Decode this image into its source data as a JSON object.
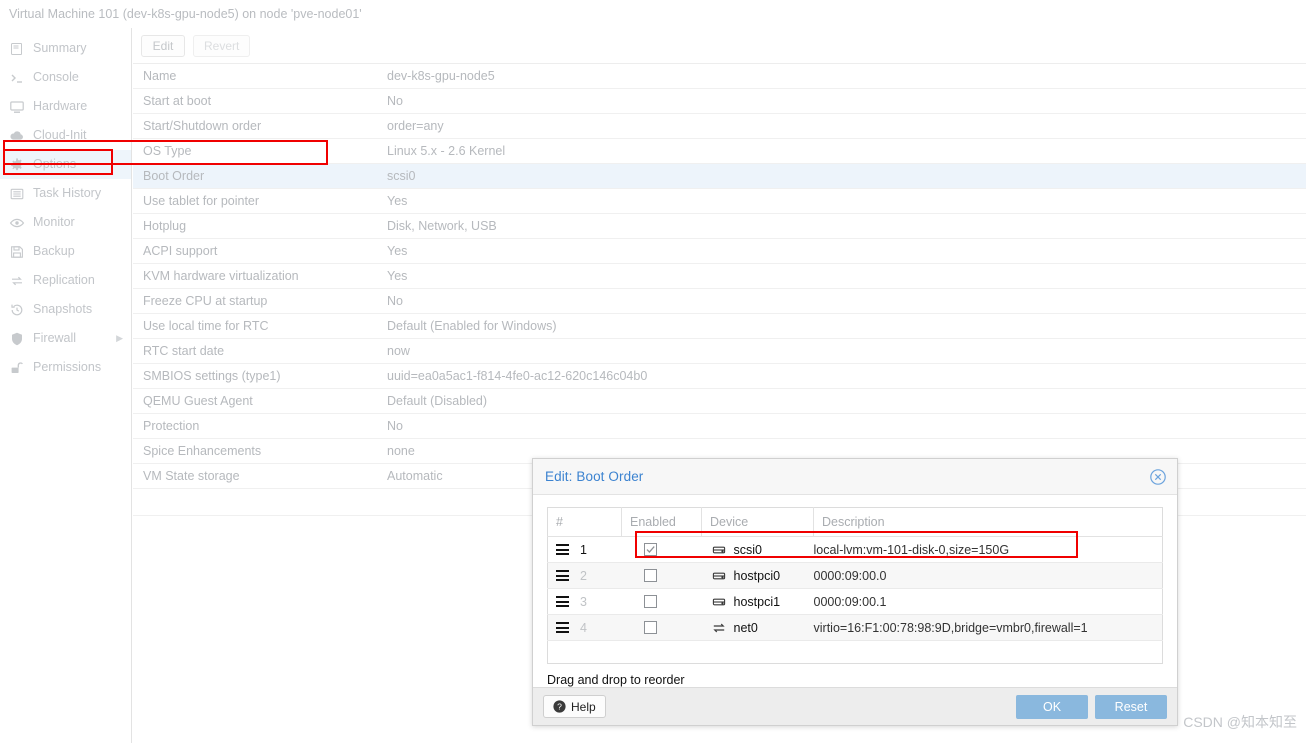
{
  "window": {
    "title": "Virtual Machine 101 (dev-k8s-gpu-node5) on node 'pve-node01'"
  },
  "sidebar": {
    "items": [
      {
        "label": "Summary",
        "icon": "summary-icon"
      },
      {
        "label": "Console",
        "icon": "console-icon"
      },
      {
        "label": "Hardware",
        "icon": "monitor-icon"
      },
      {
        "label": "Cloud-Init",
        "icon": "cloud-icon"
      },
      {
        "label": "Options",
        "icon": "gear-icon"
      },
      {
        "label": "Task History",
        "icon": "list-icon"
      },
      {
        "label": "Monitor",
        "icon": "eye-icon"
      },
      {
        "label": "Backup",
        "icon": "floppy-icon"
      },
      {
        "label": "Replication",
        "icon": "replication-icon"
      },
      {
        "label": "Snapshots",
        "icon": "history-icon"
      },
      {
        "label": "Firewall",
        "icon": "shield-icon"
      },
      {
        "label": "Permissions",
        "icon": "unlock-icon"
      }
    ],
    "selected_index": 4
  },
  "toolbar": {
    "edit_label": "Edit",
    "revert_label": "Revert"
  },
  "options": {
    "rows": [
      {
        "key": "Name",
        "value": "dev-k8s-gpu-node5"
      },
      {
        "key": "Start at boot",
        "value": "No"
      },
      {
        "key": "Start/Shutdown order",
        "value": "order=any"
      },
      {
        "key": "OS Type",
        "value": "Linux 5.x - 2.6 Kernel"
      },
      {
        "key": "Boot Order",
        "value": "scsi0"
      },
      {
        "key": "Use tablet for pointer",
        "value": "Yes"
      },
      {
        "key": "Hotplug",
        "value": "Disk, Network, USB"
      },
      {
        "key": "ACPI support",
        "value": "Yes"
      },
      {
        "key": "KVM hardware virtualization",
        "value": "Yes"
      },
      {
        "key": "Freeze CPU at startup",
        "value": "No"
      },
      {
        "key": "Use local time for RTC",
        "value": "Default (Enabled for Windows)"
      },
      {
        "key": "RTC start date",
        "value": "now"
      },
      {
        "key": "SMBIOS settings (type1)",
        "value": "uuid=ea0a5ac1-f814-4fe0-ac12-620c146c04b0"
      },
      {
        "key": "QEMU Guest Agent",
        "value": "Default (Disabled)"
      },
      {
        "key": "Protection",
        "value": "No"
      },
      {
        "key": "Spice Enhancements",
        "value": "none"
      },
      {
        "key": "VM State storage",
        "value": "Automatic"
      }
    ],
    "highlighted_index": 4
  },
  "dialog": {
    "title": "Edit: Boot Order",
    "close_icon": "close-circle-icon",
    "columns": [
      "#",
      "Enabled",
      "Device",
      "Description"
    ],
    "rows": [
      {
        "index": "1",
        "enabled": true,
        "device": "scsi0",
        "device_icon": "disk-icon",
        "description": "local-lvm:vm-101-disk-0,size=150G"
      },
      {
        "index": "2",
        "enabled": false,
        "device": "hostpci0",
        "device_icon": "disk-icon",
        "description": "0000:09:00.0"
      },
      {
        "index": "3",
        "enabled": false,
        "device": "hostpci1",
        "device_icon": "disk-icon",
        "description": "0000:09:00.1"
      },
      {
        "index": "4",
        "enabled": false,
        "device": "net0",
        "device_icon": "network-icon",
        "description": "virtio=16:F1:00:78:98:9D,bridge=vmbr0,firewall=1"
      }
    ],
    "hint": "Drag and drop to reorder",
    "footer": {
      "help_label": "Help",
      "ok_label": "OK",
      "reset_label": "Reset"
    }
  },
  "watermark": "CSDN @知本知至",
  "colors": {
    "accent": "#3c83d0",
    "annotation": "#f00000",
    "button": "#8ab8de",
    "row_highlight": "#edf4fb"
  }
}
